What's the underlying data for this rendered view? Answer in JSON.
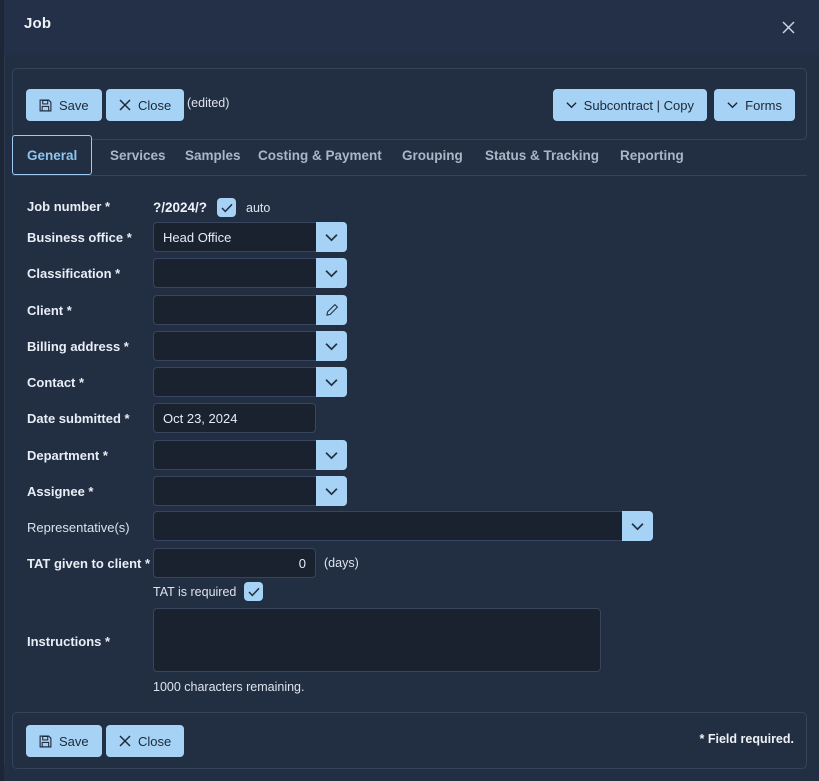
{
  "window": {
    "title": "Job",
    "close_icon": "close-x-icon"
  },
  "toolbar": {
    "save_label": "Save",
    "close_label": "Close",
    "edited_note": "(edited)",
    "subcontract_label": "Subcontract | Copy",
    "forms_label": "Forms"
  },
  "tabs": [
    {
      "label": "General",
      "active": true
    },
    {
      "label": "Services",
      "active": false
    },
    {
      "label": "Samples",
      "active": false
    },
    {
      "label": "Costing & Payment",
      "active": false
    },
    {
      "label": "Grouping",
      "active": false
    },
    {
      "label": "Status & Tracking",
      "active": false
    },
    {
      "label": "Reporting",
      "active": false
    }
  ],
  "form": {
    "job_number": {
      "label": "Job number *",
      "value": "?/2024/?",
      "auto_label": "auto",
      "auto_checked": true
    },
    "business_office": {
      "label": "Business office *",
      "value": "Head Office"
    },
    "classification": {
      "label": "Classification *",
      "value": ""
    },
    "client": {
      "label": "Client *",
      "value": ""
    },
    "billing_address": {
      "label": "Billing address *",
      "value": ""
    },
    "contact": {
      "label": "Contact *",
      "value": ""
    },
    "date_submitted": {
      "label": "Date submitted *",
      "value": "Oct 23, 2024"
    },
    "department": {
      "label": "Department *",
      "value": ""
    },
    "assignee": {
      "label": "Assignee *",
      "value": ""
    },
    "representatives": {
      "label": "Representative(s)",
      "value": ""
    },
    "tat": {
      "label": "TAT given to client *",
      "value": "0",
      "units": "(days)",
      "required_label": "TAT is required",
      "required_checked": true
    },
    "instructions": {
      "label": "Instructions *",
      "value": "",
      "remaining_note": "1000 characters remaining."
    }
  },
  "footer": {
    "save_label": "Save",
    "close_label": "Close",
    "required_note": "* Field required."
  },
  "colors": {
    "accent_button": "#a6d2f5",
    "dialog_bg": "#222e42",
    "input_bg": "#1a2230",
    "active_tab_text": "#8fc4ef",
    "border": "#36425a"
  }
}
